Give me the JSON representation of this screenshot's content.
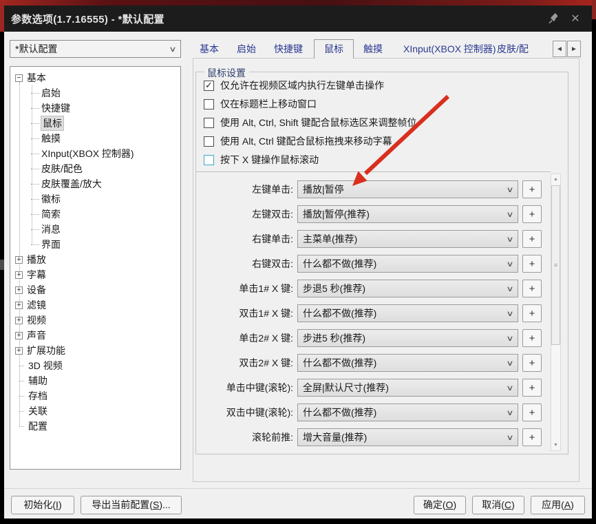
{
  "window": {
    "title": "参数选项(1.7.16555) - *默认配置"
  },
  "icons": {
    "close": "✕",
    "combo_chevron": "∨",
    "tab_prev": "◄",
    "tab_next": "►",
    "tree_collapse": "−",
    "tree_expand": "+",
    "checkmark": "✓",
    "plus": "+",
    "scroll_up": "▲",
    "scroll_down": "▼",
    "scroll_grip": "≡"
  },
  "config_selector": {
    "value": "*默认配置"
  },
  "tabs": {
    "items": [
      "基本",
      "启始",
      "快捷键",
      "鼠标",
      "触摸",
      "XInput(XBOX 控制器)",
      "皮肤/配"
    ],
    "selected": "鼠标"
  },
  "tree": {
    "items": [
      {
        "label": "基本",
        "kind": "root-expanded"
      },
      {
        "label": "启始",
        "kind": "child"
      },
      {
        "label": "快捷键",
        "kind": "child"
      },
      {
        "label": "鼠标",
        "kind": "child",
        "selected": true
      },
      {
        "label": "触摸",
        "kind": "child"
      },
      {
        "label": "XInput(XBOX 控制器)",
        "kind": "child"
      },
      {
        "label": "皮肤/配色",
        "kind": "child"
      },
      {
        "label": "皮肤覆盖/放大",
        "kind": "child"
      },
      {
        "label": "徽标",
        "kind": "child"
      },
      {
        "label": "简索",
        "kind": "child"
      },
      {
        "label": "消息",
        "kind": "child"
      },
      {
        "label": "界面",
        "kind": "child"
      },
      {
        "label": "播放",
        "kind": "root-collapsed"
      },
      {
        "label": "字幕",
        "kind": "root-collapsed"
      },
      {
        "label": "设备",
        "kind": "root-collapsed"
      },
      {
        "label": "滤镜",
        "kind": "root-collapsed"
      },
      {
        "label": "视频",
        "kind": "root-collapsed"
      },
      {
        "label": "声音",
        "kind": "root-collapsed"
      },
      {
        "label": "扩展功能",
        "kind": "root-collapsed"
      },
      {
        "label": "3D 视频",
        "kind": "leaf"
      },
      {
        "label": "辅助",
        "kind": "leaf"
      },
      {
        "label": "存档",
        "kind": "leaf"
      },
      {
        "label": "关联",
        "kind": "leaf"
      },
      {
        "label": "配置",
        "kind": "leaf"
      }
    ]
  },
  "mouse_panel": {
    "group_title": "鼠标设置",
    "checkboxes": [
      {
        "label": "仅允许在视频区域内执行左键单击操作",
        "checked": true
      },
      {
        "label": "仅在标题栏上移动窗口",
        "checked": false
      },
      {
        "label": "使用 Alt, Ctrl, Shift 键配合鼠标选区来调整帧位",
        "checked": false
      },
      {
        "label": "使用 Alt, Ctrl 键配合鼠标拖拽来移动字幕",
        "checked": false
      },
      {
        "label": "按下 X 键操作鼠标滚动",
        "checked": false,
        "focused": true
      }
    ],
    "action_rows": [
      {
        "label": "左键单击:",
        "value": "播放|暂停"
      },
      {
        "label": "左键双击:",
        "value": "播放|暂停(推荐)"
      },
      {
        "label": "右键单击:",
        "value": "主菜单(推荐)"
      },
      {
        "label": "右键双击:",
        "value": "什么都不做(推荐)"
      },
      {
        "label": "单击1# X 键:",
        "value": "步退5 秒(推荐)"
      },
      {
        "label": "双击1# X 键:",
        "value": "什么都不做(推荐)"
      },
      {
        "label": "单击2# X 键:",
        "value": "步进5 秒(推荐)"
      },
      {
        "label": "双击2# X 键:",
        "value": "什么都不做(推荐)"
      },
      {
        "label": "单击中键(滚轮):",
        "value": "全屏|默认尺寸(推荐)"
      },
      {
        "label": "双击中键(滚轮):",
        "value": "什么都不做(推荐)"
      },
      {
        "label": "滚轮前推:",
        "value": "增大音量(推荐)"
      }
    ]
  },
  "footer": {
    "init_button": "初始化(I)",
    "export_button": "导出当前配置(S)...",
    "ok_button": "确定(O)",
    "cancel_button": "取消(C)",
    "apply_button": "应用(A)"
  },
  "colors": {
    "titlebar_bg": "#1c1c1c",
    "tab_text": "#2b3990",
    "focus_checkbox_border": "#3aa7cc",
    "annotation_arrow": "#d92f1e",
    "tree_selection_bg": "#dfdfdf"
  }
}
